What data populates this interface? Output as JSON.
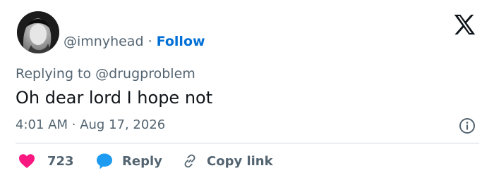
{
  "user": {
    "handle": "@imnyhead",
    "separator": "·",
    "follow_label": "Follow"
  },
  "tweet": {
    "reply_prefix": "Replying to",
    "reply_to": "@drugproblem",
    "text": "Oh dear lord I hope not",
    "time": "4:01 AM",
    "date": "Aug 17, 2026"
  },
  "actions": {
    "likes_count": "723",
    "reply_label": "Reply",
    "copy_label": "Copy link"
  },
  "icons": {
    "logo": "x-logo-icon",
    "info": "info-icon",
    "like": "heart-icon",
    "reply": "speech-bubble-icon",
    "copy": "link-icon"
  },
  "colors": {
    "follow": "#006fd6",
    "muted": "#536471",
    "heart": "#f91880",
    "reply_bubble": "#1d9bf0"
  }
}
